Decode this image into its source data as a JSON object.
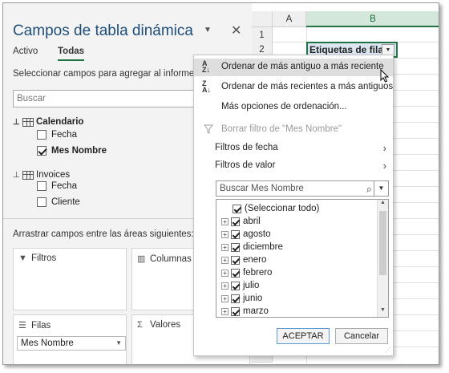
{
  "pane": {
    "title": "Campos de tabla dinámica",
    "tabs": [
      "Activo",
      "Todas"
    ],
    "active_tab": "Todas",
    "instruction": "Seleccionar campos para agregar al informe:",
    "search_placeholder": "Buscar",
    "tables": [
      {
        "name": "Calendario",
        "fields": [
          {
            "label": "Fecha",
            "checked": false
          },
          {
            "label": "Mes Nombre",
            "checked": true
          }
        ]
      },
      {
        "name": "Invoices",
        "fields": [
          {
            "label": "Fecha",
            "checked": false
          },
          {
            "label": "Cliente",
            "checked": false
          }
        ]
      }
    ],
    "areas_instruction": "Arrastrar campos entre las áreas siguientes:",
    "areas": {
      "filtros": "Filtros",
      "columnas": "Columnas",
      "filas": "Filas",
      "valores": "Valores"
    },
    "filas_chip": "Mes Nombre"
  },
  "sheet": {
    "columns": [
      "A",
      "B"
    ],
    "rows": [
      "1",
      "2"
    ],
    "header_cell": "Etiquetas de fila"
  },
  "menu": {
    "sort_asc": "Ordenar de más antiguo a más reciente",
    "sort_desc": "Ordenar de más recientes a más antiguos",
    "more_sort": "Más opciones de ordenación...",
    "clear_filter": "Borrar filtro de \"Mes Nombre\"",
    "date_filters": "Filtros de fecha",
    "value_filters": "Filtros de valor",
    "search_placeholder": "Buscar Mes Nombre",
    "items": [
      {
        "label": "(Seleccionar todo)",
        "checked": true,
        "expandable": false
      },
      {
        "label": "abril",
        "checked": true,
        "expandable": true
      },
      {
        "label": "agosto",
        "checked": true,
        "expandable": true
      },
      {
        "label": "diciembre",
        "checked": true,
        "expandable": true
      },
      {
        "label": "enero",
        "checked": true,
        "expandable": true
      },
      {
        "label": "febrero",
        "checked": true,
        "expandable": true
      },
      {
        "label": "julio",
        "checked": true,
        "expandable": true
      },
      {
        "label": "junio",
        "checked": true,
        "expandable": true
      },
      {
        "label": "marzo",
        "checked": true,
        "expandable": true
      }
    ],
    "accept": "ACEPTAR",
    "cancel": "Cancelar",
    "sort_icon_asc": "sort-a-z-icon",
    "sort_icon_desc": "sort-z-a-icon"
  },
  "colors": {
    "title_blue": "#1e4e79",
    "excel_green": "#217346",
    "hover_gray": "#dedede"
  }
}
